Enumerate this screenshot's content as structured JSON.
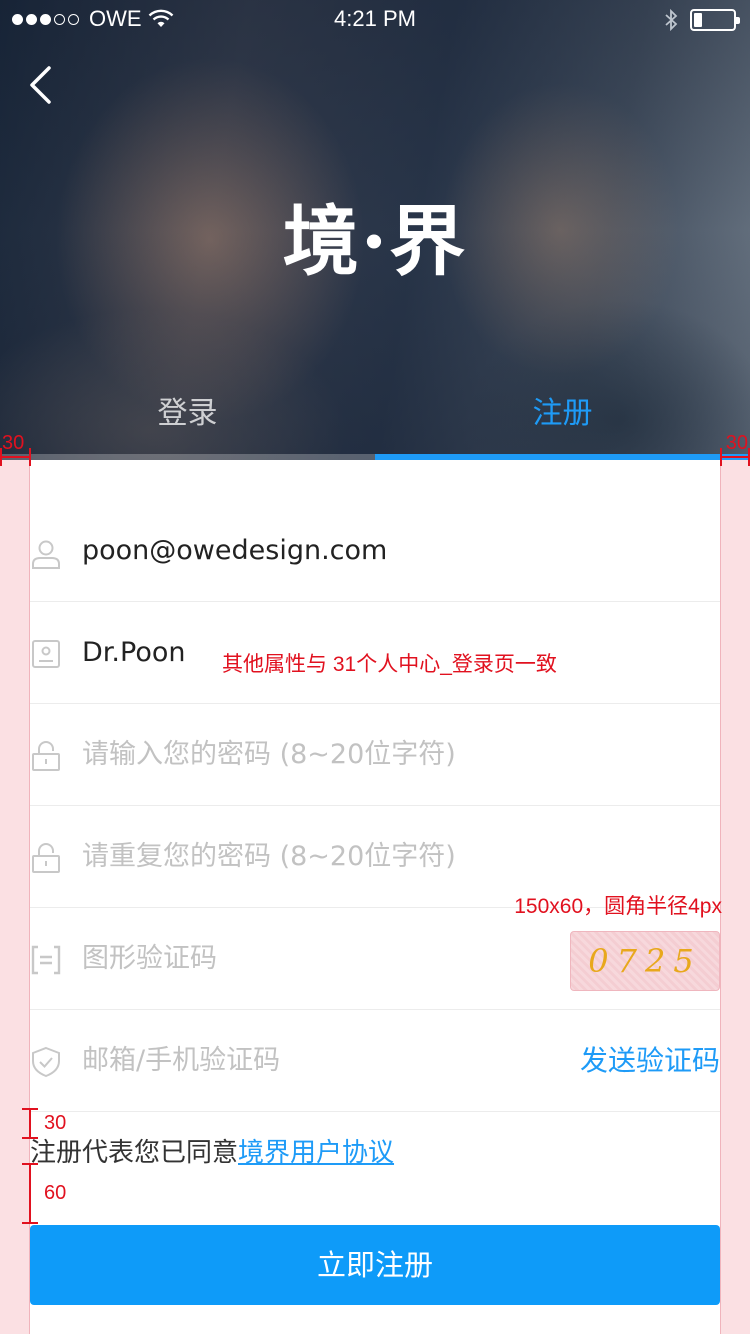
{
  "status_bar": {
    "carrier": "OWE",
    "time": "4:21 PM"
  },
  "hero": {
    "brand": "境·界"
  },
  "tabs": [
    {
      "label": "登录",
      "active": false
    },
    {
      "label": "注册",
      "active": true
    }
  ],
  "form": {
    "email": {
      "value": "poon@owedesign.com"
    },
    "nickname": {
      "value": "Dr.Poon"
    },
    "password": {
      "placeholder": "请输入您的密码 (8~20位字符)"
    },
    "password_repeat": {
      "placeholder": "请重复您的密码 (8~20位字符)"
    },
    "graphic_code": {
      "placeholder": "图形验证码",
      "captcha_text": "0725"
    },
    "verify_code": {
      "placeholder": "邮箱/手机验证码",
      "send_label": "发送验证码"
    }
  },
  "agreement": {
    "prefix": "注册代表您已同意",
    "link": "境界用户协议"
  },
  "submit_label": "立即注册",
  "spec_annotations": {
    "margin_left": "30",
    "margin_right": "30",
    "note_same_as_login": "其他属性与 31个人中心_登录页一致",
    "captcha_note": "150x60，圆角半径4px",
    "gap_top": "30",
    "gap_bottom": "60"
  },
  "colors": {
    "accent": "#1e9bf7",
    "button": "#0e9bf9",
    "annotation": "#e1111f",
    "guide": "#fbe0e3"
  }
}
